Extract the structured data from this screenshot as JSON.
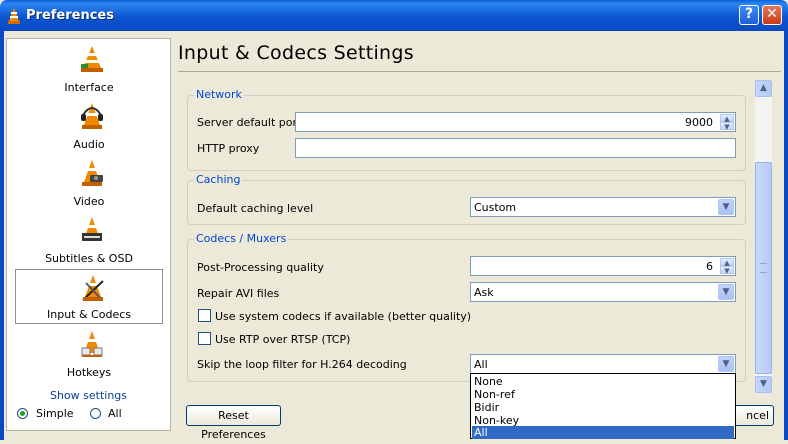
{
  "window": {
    "title": "Preferences",
    "help_icon": "help-icon",
    "close_icon": "close-icon",
    "help_glyph": "?",
    "close_glyph": "✕"
  },
  "sidebar": {
    "items": [
      {
        "label": "Interface",
        "icon": "vlc-cone-interface-icon"
      },
      {
        "label": "Audio",
        "icon": "vlc-cone-headphones-icon"
      },
      {
        "label": "Video",
        "icon": "vlc-cone-video-icon"
      },
      {
        "label": "Subtitles & OSD",
        "icon": "vlc-cone-subtitles-icon"
      },
      {
        "label": "Input & Codecs",
        "icon": "vlc-cone-codecs-icon",
        "selected": true
      },
      {
        "label": "Hotkeys",
        "icon": "vlc-cone-hotkeys-icon"
      }
    ],
    "show_settings_label": "Show settings",
    "mode_options": [
      {
        "label": "Simple",
        "checked": true
      },
      {
        "label": "All",
        "checked": false
      }
    ]
  },
  "main": {
    "title": "Input & Codecs Settings",
    "network": {
      "group_title": "Network",
      "server_port_label": "Server default port",
      "server_port_value": "9000",
      "http_proxy_label": "HTTP proxy",
      "http_proxy_value": ""
    },
    "caching": {
      "group_title": "Caching",
      "level_label": "Default caching level",
      "level_value": "Custom"
    },
    "codecs": {
      "group_title": "Codecs / Muxers",
      "pp_quality_label": "Post-Processing quality",
      "pp_quality_value": "6",
      "repair_avi_label": "Repair AVI files",
      "repair_avi_value": "Ask",
      "system_codecs_label": "Use system codecs if available (better quality)",
      "system_codecs_checked": false,
      "rtp_rtsp_label": "Use RTP over RTSP (TCP)",
      "rtp_rtsp_checked": false,
      "loop_filter_label": "Skip the loop filter for H.264 decoding",
      "loop_filter_value": "All"
    },
    "loop_filter_options": [
      "None",
      "Non-ref",
      "Bidir",
      "Non-key",
      "All"
    ],
    "loop_filter_highlighted": "All"
  },
  "footer": {
    "reset_label": "Reset Preferences",
    "cancel_label_visible": "ncel"
  },
  "colors": {
    "titlebar": "#0a5fd8",
    "group_title": "#0046d5",
    "highlight": "#316ac5",
    "vlc_orange": "#f08a00"
  }
}
